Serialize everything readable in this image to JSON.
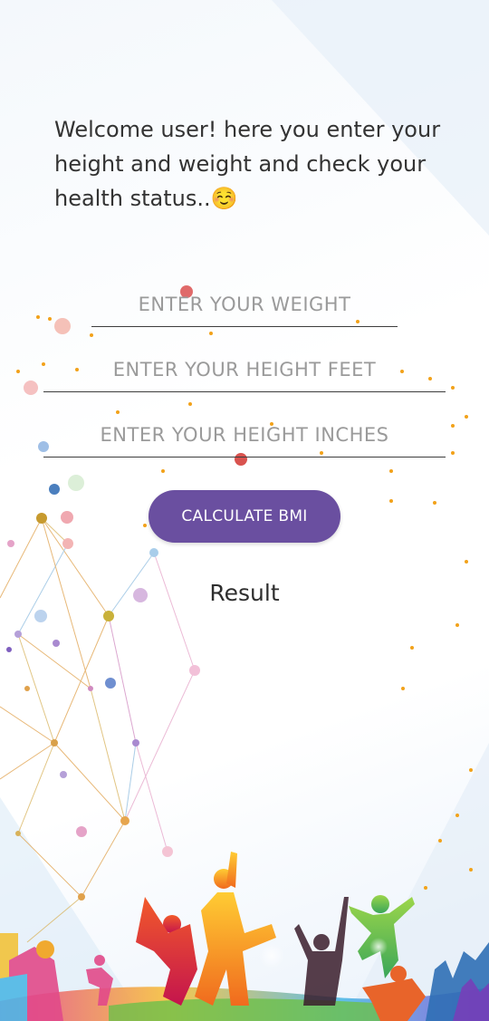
{
  "welcome_text": "Welcome user! here you enter your height and weight and check your health status..☺️",
  "form": {
    "weight_placeholder": "ENTER YOUR WEIGHT",
    "weight_value": "",
    "height_feet_placeholder": "ENTER YOUR HEIGHT FEET",
    "height_feet_value": "",
    "height_inches_placeholder": "ENTER YOUR HEIGHT INCHES",
    "height_inches_value": ""
  },
  "calculate_button_label": "CALCULATE BMI",
  "result_label": "Result",
  "colors": {
    "button": "#6a4fa0",
    "text": "#333333"
  }
}
